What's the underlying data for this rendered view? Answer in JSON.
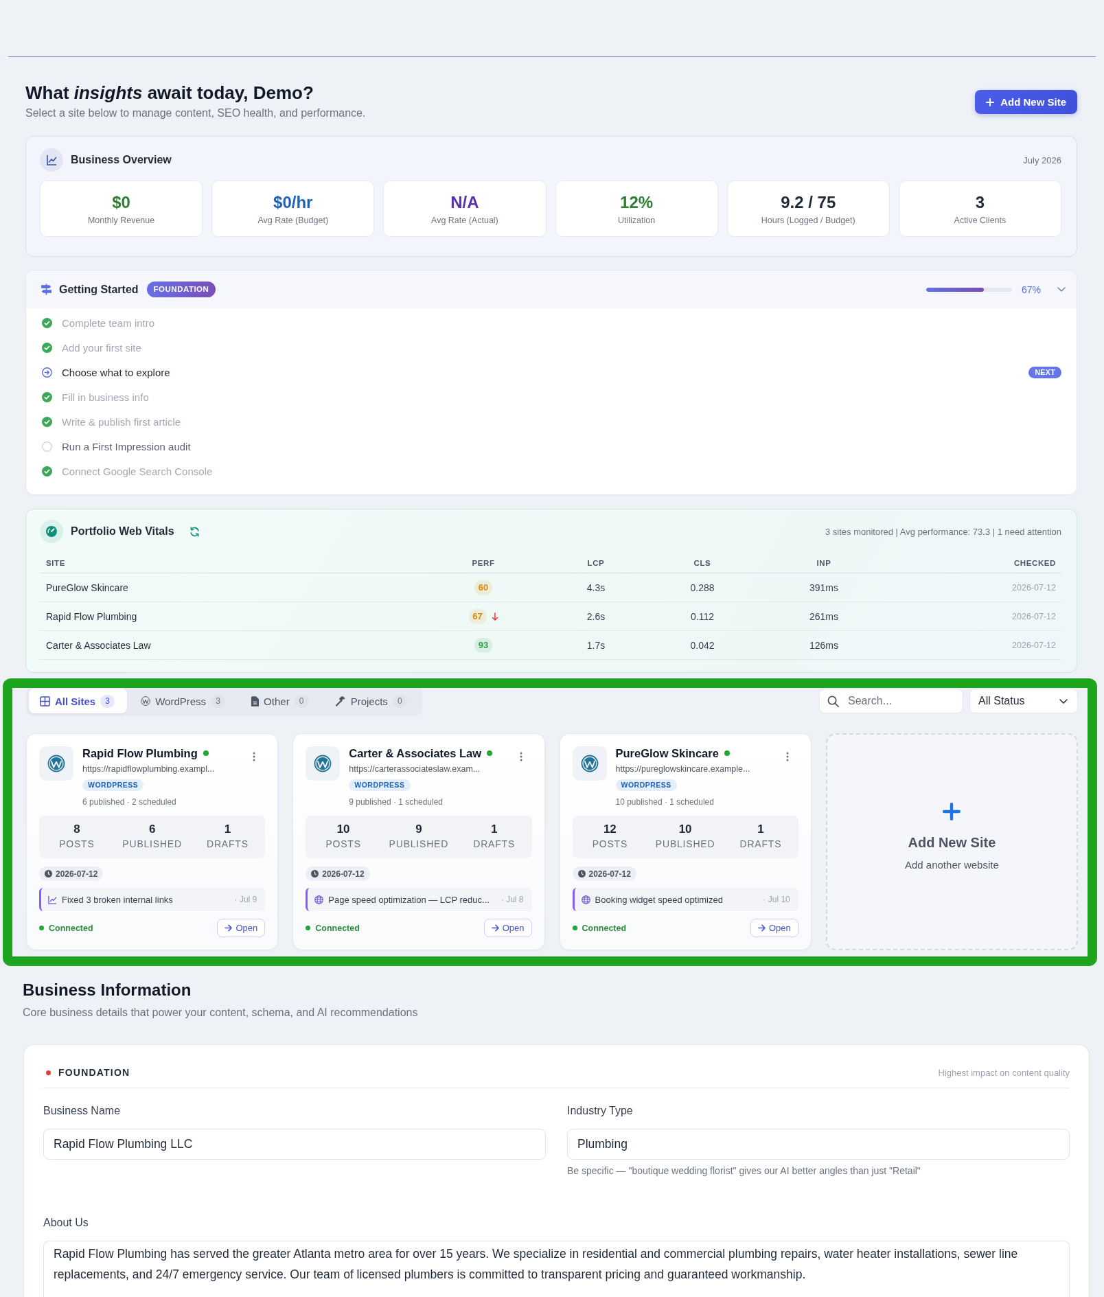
{
  "header": {
    "title": "What *insights* await today, Demo?",
    "subtitle": "Select a site below to manage content, SEO health, and performance.",
    "button": "Add New Site"
  },
  "business_overview": {
    "title": "Business Overview",
    "period": "July 2026",
    "stats": [
      {
        "value": "$0",
        "label": "Monthly Revenue",
        "color": "#2e7d32"
      },
      {
        "value": "$0/hr",
        "label": "Avg Rate (Budget)",
        "color": "#1e63b8"
      },
      {
        "value": "N/A",
        "label": "Avg Rate (Actual)",
        "color": "#5b2fae"
      },
      {
        "value": "12%",
        "label": "Utilization",
        "color": "#2e7d32"
      },
      {
        "value": "9.2 / 75",
        "label": "Hours (Logged / Budget)",
        "color": "#1f2937"
      },
      {
        "value": "3",
        "label": "Active Clients",
        "color": "#1f2937"
      }
    ]
  },
  "getting_started": {
    "title": "Getting Started",
    "badge": "FOUNDATION",
    "level": 0.67,
    "percent": "67%",
    "expanded": true,
    "steps": [
      {
        "label": "Complete team intro",
        "completed": true,
        "current": false
      },
      {
        "label": "Add your first site",
        "completed": true,
        "current": false
      },
      {
        "label": "Choose what to explore",
        "completed": false,
        "current": true,
        "badge": "NEXT"
      },
      {
        "label": "Fill in business info",
        "completed": true,
        "current": false
      },
      {
        "label": "Write & publish first article",
        "completed": true,
        "current": false
      },
      {
        "label": "Run a First Impression audit",
        "completed": false,
        "current": false
      },
      {
        "label": "Connect Google Search Console",
        "completed": true,
        "current": false
      }
    ]
  },
  "web_vitals": {
    "title": "Portfolio Web Vitals",
    "summary": "3 sites monitored | Avg performance: 73.3 | 1 need attention",
    "columns": [
      "SITE",
      "PERF",
      "LCP",
      "CLS",
      "INP",
      "CHECKED"
    ],
    "rows": [
      {
        "site": "PureGlow Skincare",
        "perf": "60",
        "color": "#e08a00",
        "declining": false,
        "lcp": "4.3s",
        "cls": "0.288",
        "inp": "391ms",
        "checked": "2026-07-12"
      },
      {
        "site": "Rapid Flow Plumbing",
        "perf": "67",
        "color": "#e08a00",
        "declining": true,
        "lcp": "2.6s",
        "cls": "0.112",
        "inp": "261ms",
        "checked": "2026-07-12"
      },
      {
        "site": "Carter & Associates Law",
        "perf": "93",
        "color": "#2e9e48",
        "declining": false,
        "lcp": "1.7s",
        "cls": "0.042",
        "inp": "126ms",
        "checked": "2026-07-12"
      }
    ]
  },
  "sites": {
    "tabs": [
      {
        "kind": "all",
        "label": "All Sites",
        "count": "3",
        "selected": true
      },
      {
        "kind": "wordpress",
        "label": "WordPress",
        "count": "3",
        "selected": false
      },
      {
        "kind": "other",
        "label": "Other",
        "count": "0",
        "selected": false
      },
      {
        "kind": "projects",
        "label": "Projects",
        "count": "0",
        "selected": false
      }
    ],
    "search": {
      "placeholder": "Search..."
    },
    "status_filter": {
      "value": "All Status"
    },
    "cards": [
      {
        "name": "Rapid Flow Plumbing",
        "online": true,
        "url": "https://rapidflowplumbing.exampl...",
        "platform": "WORDPRESS",
        "summary": "6 published · 2 scheduled",
        "stats": [
          {
            "value": "8",
            "label": "POSTS"
          },
          {
            "value": "6",
            "label": "PUBLISHED"
          },
          {
            "value": "1",
            "label": "DRAFTS"
          }
        ],
        "date": "2026-07-12",
        "activity": {
          "kind": "seo",
          "text": "Fixed 3 broken internal links",
          "date": "· Jul 9"
        },
        "connection": "Connected",
        "connected": true,
        "button": "Open"
      },
      {
        "name": "Carter & Associates Law",
        "online": true,
        "url": "https://carterassociateslaw.exam...",
        "platform": "WORDPRESS",
        "summary": "9 published · 1 scheduled",
        "stats": [
          {
            "value": "10",
            "label": "POSTS"
          },
          {
            "value": "9",
            "label": "PUBLISHED"
          },
          {
            "value": "1",
            "label": "DRAFTS"
          }
        ],
        "date": "2026-07-12",
        "activity": {
          "kind": "speed",
          "text": "Page speed optimization — LCP reduc...",
          "date": "· Jul 8"
        },
        "connection": "Connected",
        "connected": true,
        "button": "Open"
      },
      {
        "name": "PureGlow Skincare",
        "online": true,
        "url": "https://pureglowskincare.example...",
        "platform": "WORDPRESS",
        "summary": "10 published · 1 scheduled",
        "stats": [
          {
            "value": "12",
            "label": "POSTS"
          },
          {
            "value": "10",
            "label": "PUBLISHED"
          },
          {
            "value": "1",
            "label": "DRAFTS"
          }
        ],
        "date": "2026-07-12",
        "activity": {
          "kind": "speed",
          "text": "Booking widget speed optimized",
          "date": "· Jul 10"
        },
        "connection": "Connected",
        "connected": true,
        "button": "Open"
      }
    ],
    "add_card": {
      "title": "Add New Site",
      "subtitle": "Add another website"
    }
  },
  "business_information": {
    "title": "Business Information",
    "subtitle": "Core business details that power your content, schema, and AI recommendations",
    "group": {
      "title": "FOUNDATION",
      "note": "Highest impact on content quality"
    },
    "fields": [
      {
        "kind": "input",
        "label": "Business Name",
        "value": "Rapid Flow Plumbing LLC"
      },
      {
        "kind": "input",
        "label": "Industry Type",
        "value": "Plumbing",
        "hint": "Be specific — \"boutique wedding florist\" gives our AI better angles than just \"Retail\""
      },
      {
        "kind": "textarea",
        "label": "About Us",
        "value": "Rapid Flow Plumbing has served the greater Atlanta metro area for over 15 years. We specialize in residential and commercial plumbing repairs, water heater installations, sewer line replacements, and 24/7 emergency service. Our team of licensed plumbers is committed to transparent pricing and guaranteed workmanship."
      }
    ]
  }
}
